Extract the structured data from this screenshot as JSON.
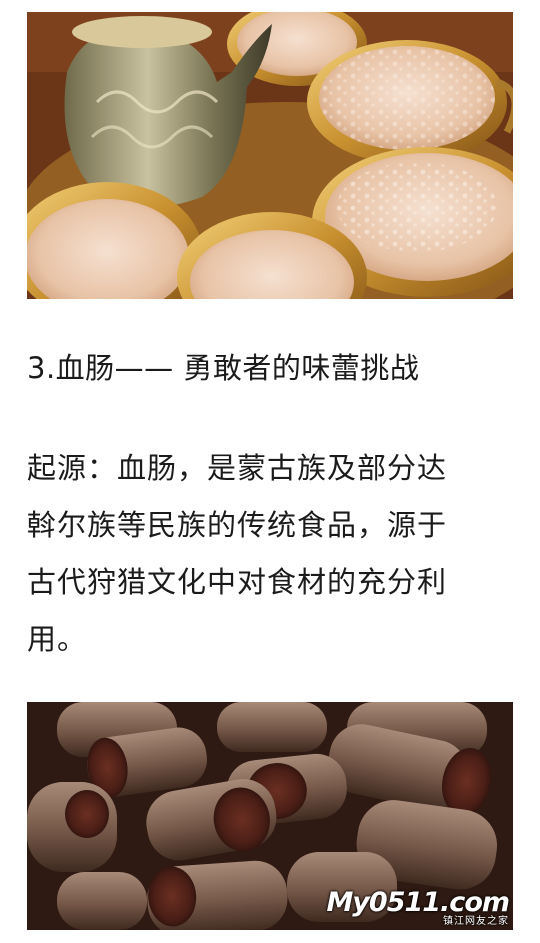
{
  "article": {
    "heading": "3.血肠—— 勇敢者的味蕾挑战",
    "paragraph_lines": [
      "起源：血肠，是蒙古族及部分达",
      "斡尔族等民族的传统食品，源于",
      "古代狩猎文化中对食材的充分利",
      "用。"
    ]
  },
  "images": {
    "top": {
      "subject": "milk-tea-cups-and-silver-teapot"
    },
    "bottom": {
      "subject": "sliced-blood-sausage",
      "watermark_logo": "My0511.com",
      "watermark_sub": "镇江网友之家"
    }
  }
}
